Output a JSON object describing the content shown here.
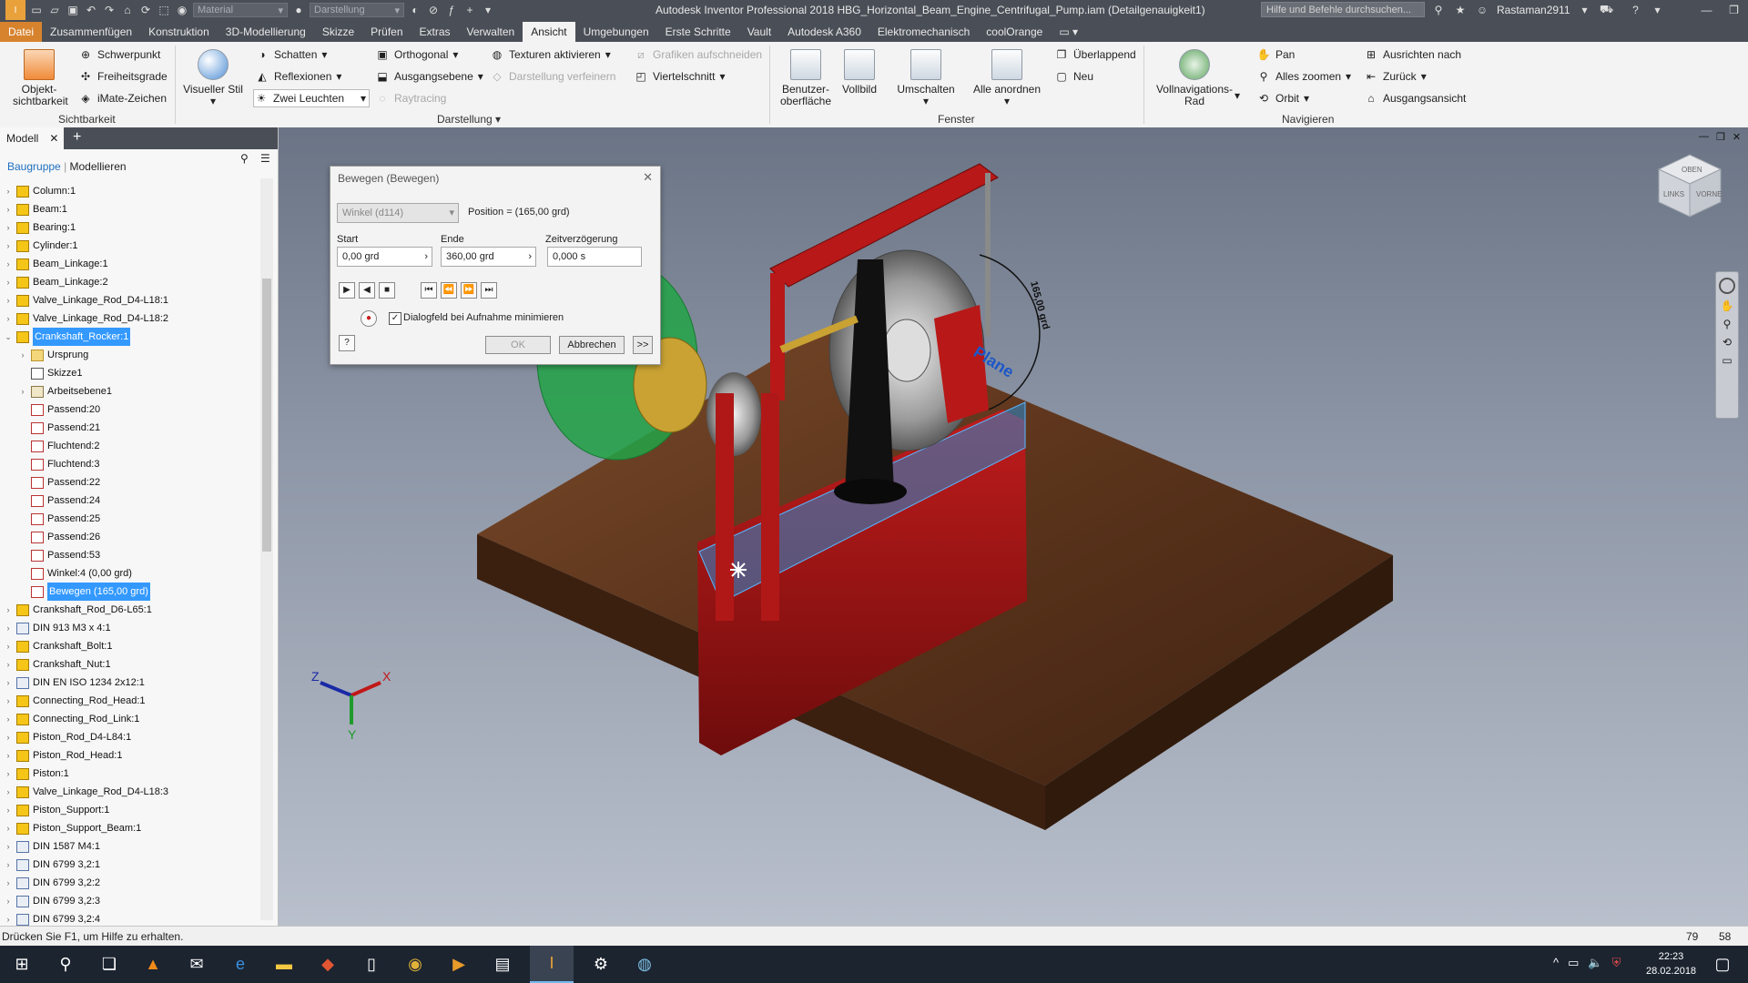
{
  "titlebar": {
    "app_title": "Autodesk Inventor Professional 2018   HBG_Horizontal_Beam_Engine_Centrifugal_Pump.iam (Detailgenauigkeit1)",
    "material_placeholder": "Material",
    "appearance_placeholder": "Darstellung",
    "help_search_placeholder": "Hilfe und Befehle durchsuchen...",
    "user": "Rastaman2911"
  },
  "menu": {
    "file": "Datei",
    "tabs": [
      "Zusammenfügen",
      "Konstruktion",
      "3D-Modellierung",
      "Skizze",
      "Prüfen",
      "Extras",
      "Verwalten",
      "Ansicht",
      "Umgebungen",
      "Erste Schritte",
      "Vault",
      "Autodesk A360",
      "Elektromechanisch",
      "coolOrange"
    ],
    "active": "Ansicht"
  },
  "ribbon": {
    "sichtbarkeit": {
      "label": "Sichtbarkeit",
      "objekt": "Objekt-\nsichtbarkeit",
      "items": [
        "Schwerpunkt",
        "Freiheitsgrade",
        "iMate-Zeichen"
      ]
    },
    "darstellung": {
      "label": "Darstellung",
      "visueller_stil": "Visueller Stil",
      "schatten": "Schatten",
      "reflexionen": "Reflexionen",
      "zwei_leuchten": "Zwei Leuchten",
      "orthogonal": "Orthogonal",
      "ausgangsebene": "Ausgangsebene",
      "raytracing": "Raytracing",
      "texturen": "Texturen aktivieren",
      "verfeinern": "Darstellung verfeinern",
      "grafiken": "Grafiken aufschneiden",
      "viertelschnitt": "Viertelschnitt"
    },
    "fenster": {
      "label": "Fenster",
      "benutzer": "Benutzer-\noberfläche",
      "vollbild": "Vollbild",
      "umschalten": "Umschalten",
      "alle_anordnen": "Alle anordnen",
      "ueberlappend": "Überlappend",
      "neu": "Neu"
    },
    "navigieren": {
      "label": "Navigieren",
      "vollnav": "Vollnavigations-\nRad",
      "pan": "Pan",
      "alles_zoomen": "Alles zoomen",
      "orbit": "Orbit",
      "ausrichten": "Ausrichten nach",
      "zurueck": "Zurück",
      "ausgangsansicht": "Ausgangsansicht"
    }
  },
  "browser": {
    "tab": "Modell",
    "sub_active": "Baugruppe",
    "sub_other": "Modellieren",
    "items": [
      {
        "label": "Column:1",
        "icon": "asm",
        "indent": 0,
        "exp": "›"
      },
      {
        "label": "Beam:1",
        "icon": "asm",
        "indent": 0,
        "exp": "›"
      },
      {
        "label": "Bearing:1",
        "icon": "asm",
        "indent": 0,
        "exp": "›"
      },
      {
        "label": "Cylinder:1",
        "icon": "asm",
        "indent": 0,
        "exp": "›"
      },
      {
        "label": "Beam_Linkage:1",
        "icon": "asm",
        "indent": 0,
        "exp": "›"
      },
      {
        "label": "Beam_Linkage:2",
        "icon": "asm",
        "indent": 0,
        "exp": "›"
      },
      {
        "label": "Valve_Linkage_Rod_D4-L18:1",
        "icon": "asm",
        "indent": 0,
        "exp": "›"
      },
      {
        "label": "Valve_Linkage_Rod_D4-L18:2",
        "icon": "asm",
        "indent": 0,
        "exp": "›"
      },
      {
        "label": "Crankshaft_Rocker:1",
        "icon": "asm",
        "indent": 0,
        "exp": "⌄",
        "sel": true
      },
      {
        "label": "Ursprung",
        "icon": "folder",
        "indent": 1,
        "exp": "›"
      },
      {
        "label": "Skizze1",
        "icon": "sketch",
        "indent": 1,
        "exp": ""
      },
      {
        "label": "Arbeitsebene1",
        "icon": "plane",
        "indent": 1,
        "exp": "›"
      },
      {
        "label": "Passend:20",
        "icon": "cons",
        "indent": 1,
        "exp": ""
      },
      {
        "label": "Passend:21",
        "icon": "cons",
        "indent": 1,
        "exp": ""
      },
      {
        "label": "Fluchtend:2",
        "icon": "cons",
        "indent": 1,
        "exp": ""
      },
      {
        "label": "Fluchtend:3",
        "icon": "cons",
        "indent": 1,
        "exp": ""
      },
      {
        "label": "Passend:22",
        "icon": "cons",
        "indent": 1,
        "exp": ""
      },
      {
        "label": "Passend:24",
        "icon": "cons",
        "indent": 1,
        "exp": ""
      },
      {
        "label": "Passend:25",
        "icon": "cons",
        "indent": 1,
        "exp": ""
      },
      {
        "label": "Passend:26",
        "icon": "cons",
        "indent": 1,
        "exp": ""
      },
      {
        "label": "Passend:53",
        "icon": "cons",
        "indent": 1,
        "exp": ""
      },
      {
        "label": "Winkel:4 (0,00 grd)",
        "icon": "cons",
        "indent": 1,
        "exp": ""
      },
      {
        "label": "Bewegen (165,00 grd)",
        "icon": "cons",
        "indent": 1,
        "exp": "",
        "sel": true
      },
      {
        "label": "Crankshaft_Rod_D6-L65:1",
        "icon": "asm",
        "indent": 0,
        "exp": "›"
      },
      {
        "label": "DIN 913 M3 x 4:1",
        "icon": "part",
        "indent": 0,
        "exp": "›"
      },
      {
        "label": "Crankshaft_Bolt:1",
        "icon": "asm",
        "indent": 0,
        "exp": "›"
      },
      {
        "label": "Crankshaft_Nut:1",
        "icon": "asm",
        "indent": 0,
        "exp": "›"
      },
      {
        "label": "DIN EN ISO 1234 2x12:1",
        "icon": "part",
        "indent": 0,
        "exp": "›"
      },
      {
        "label": "Connecting_Rod_Head:1",
        "icon": "asm",
        "indent": 0,
        "exp": "›"
      },
      {
        "label": "Connecting_Rod_Link:1",
        "icon": "asm",
        "indent": 0,
        "exp": "›"
      },
      {
        "label": "Piston_Rod_D4-L84:1",
        "icon": "asm",
        "indent": 0,
        "exp": "›"
      },
      {
        "label": "Piston_Rod_Head:1",
        "icon": "asm",
        "indent": 0,
        "exp": "›"
      },
      {
        "label": "Piston:1",
        "icon": "asm",
        "indent": 0,
        "exp": "›"
      },
      {
        "label": "Valve_Linkage_Rod_D4-L18:3",
        "icon": "asm",
        "indent": 0,
        "exp": "›"
      },
      {
        "label": "Piston_Support:1",
        "icon": "asm",
        "indent": 0,
        "exp": "›"
      },
      {
        "label": "Piston_Support_Beam:1",
        "icon": "asm",
        "indent": 0,
        "exp": "›"
      },
      {
        "label": "DIN 1587 M4:1",
        "icon": "part",
        "indent": 0,
        "exp": "›"
      },
      {
        "label": "DIN 6799 3,2:1",
        "icon": "part",
        "indent": 0,
        "exp": "›"
      },
      {
        "label": "DIN 6799 3,2:2",
        "icon": "part",
        "indent": 0,
        "exp": "›"
      },
      {
        "label": "DIN 6799 3,2:3",
        "icon": "part",
        "indent": 0,
        "exp": "›"
      },
      {
        "label": "DIN 6799 3,2:4",
        "icon": "part",
        "indent": 0,
        "exp": "›"
      }
    ]
  },
  "dialog": {
    "title": "Bewegen (Bewegen)",
    "constraint_select": "Winkel (d114)",
    "position": "Position = (165,00 grd)",
    "start_label": "Start",
    "start_value": "0,00 grd",
    "end_label": "Ende",
    "end_value": "360,00 grd",
    "delay_label": "Zeitverzögerung",
    "delay_value": "0,000 s",
    "minimize_label": "Dialogfeld bei Aufnahme minimieren",
    "ok": "OK",
    "cancel": "Abbrechen",
    "more": ">>"
  },
  "viewport": {
    "plane_label": "Plane",
    "dimension_label": "165,00 grd",
    "viewcube_top": "OBEN",
    "viewcube_left": "LINKS",
    "viewcube_front": "VORNE",
    "axis_x": "X",
    "axis_y": "Y",
    "axis_z": "Z"
  },
  "status": {
    "message": "Drücken Sie F1, um Hilfe zu erhalten.",
    "count1": "79",
    "count2": "58"
  },
  "taskbar": {
    "time": "22:23",
    "date": "28.02.2018"
  },
  "colors": {
    "chrome": "#4a4f57",
    "file_tab": "#d7832e",
    "selection": "#3399ff"
  }
}
